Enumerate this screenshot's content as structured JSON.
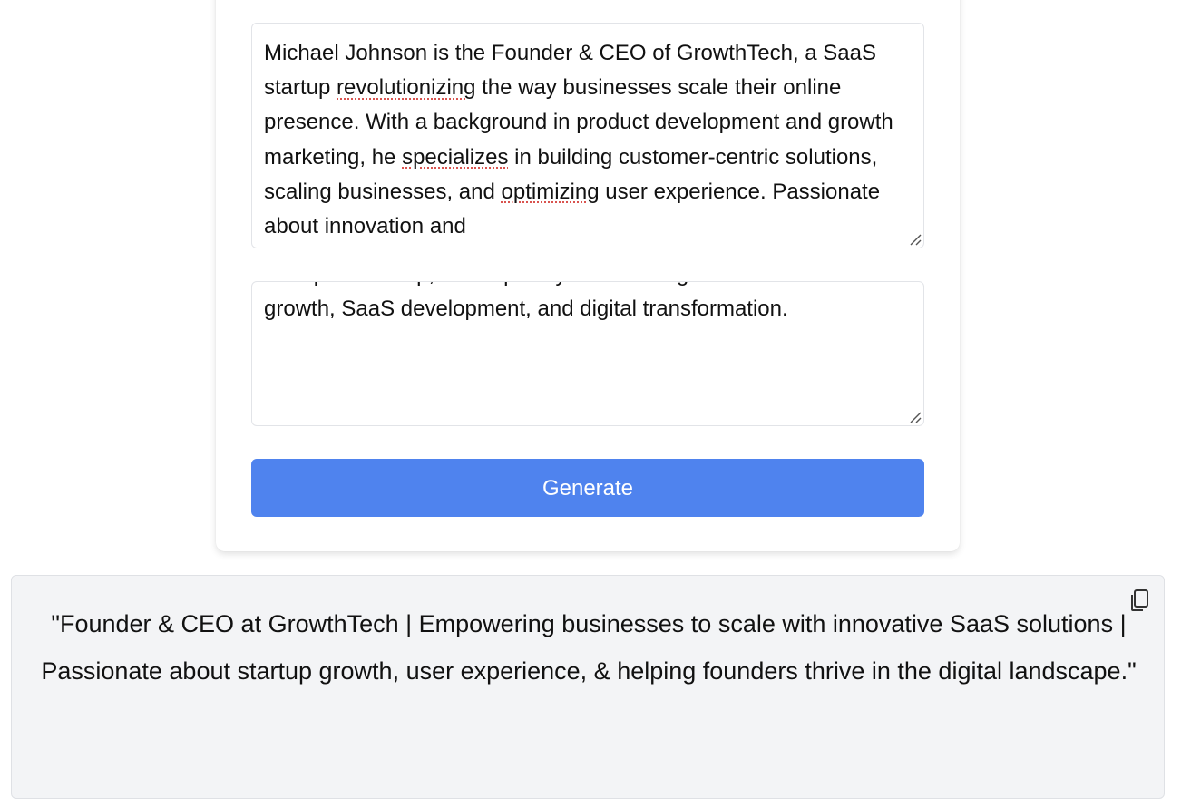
{
  "form": {
    "bio_textarea": {
      "before_1": "Michael Johnson is the Founder & CEO of GrowthTech, a SaaS startup ",
      "misspelled_1": "revolutionizing",
      "between_1": " the way businesses scale their online presence. With a background in product development and growth marketing, he ",
      "misspelled_2": "specializes",
      "between_2": " in building customer-centric solutions, scaling businesses, and ",
      "misspelled_3": "optimizing",
      "after": " user experience. Passionate about innovation and"
    },
    "second_textarea": {
      "value": "entrepreneurship, he frequently shares insights on business growth, SaaS development, and digital transformation."
    },
    "generate_label": "Generate"
  },
  "result": {
    "text": "\"Founder & CEO at GrowthTech | Empowering businesses to scale with innovative SaaS solutions | Passionate about startup growth, user experience, & helping founders thrive in the digital landscape.\"",
    "copy_icon": "copy-icon"
  },
  "colors": {
    "button_bg": "#4f83ee",
    "result_bg": "#f3f4f6",
    "spellcheck_underline": "#d9534f"
  }
}
